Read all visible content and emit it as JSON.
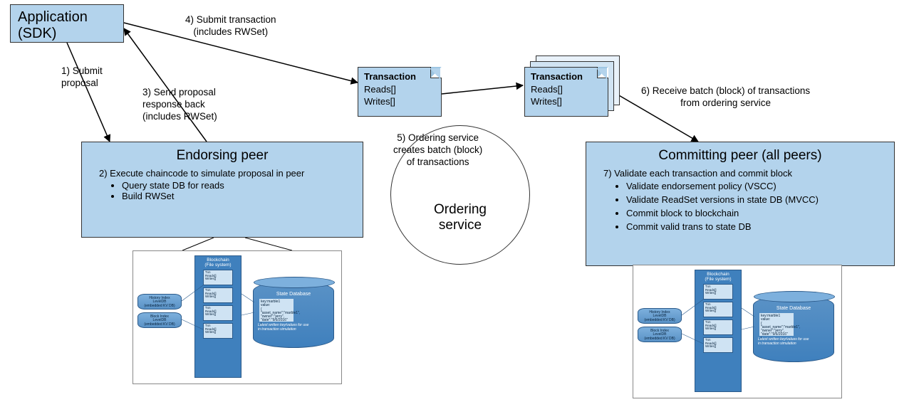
{
  "app": {
    "line1": "Application",
    "line2": "(SDK)"
  },
  "steps": {
    "s1": "1) Submit\nproposal",
    "s3": "3) Send proposal\nresponse back\n(includes RWSet)",
    "s4": "4) Submit transaction\n(includes RWSet)",
    "s5": "5) Ordering service\ncreates batch (block)\nof transactions",
    "s6": "6) Receive batch (block) of transactions\nfrom ordering service"
  },
  "endorsing": {
    "title": "Endorsing peer",
    "line": "2) Execute chaincode to simulate proposal in peer",
    "bullets": [
      "Query state DB for reads",
      "Build RWSet"
    ]
  },
  "committing": {
    "title": "Committing peer (all peers)",
    "line": "7) Validate each transaction and commit block",
    "bullets": [
      "Validate endorsement policy (VSCC)",
      "Validate ReadSet versions in state DB (MVCC)",
      "Commit block to blockchain",
      "Commit valid trans to state DB"
    ]
  },
  "tx_card": {
    "title": "Transaction",
    "r": "Reads[]",
    "w": "Writes[]"
  },
  "ordering": {
    "label": "Ordering\nservice"
  },
  "ledger": {
    "history_index": "History Index\nLevelDB\n(embedded KV DB)",
    "block_index": "Block Index\nLevelDB\n(embedded KV DB)",
    "blockchain_hdr": "Blockchain\n(File system)",
    "tiny": "Txn\nReads[]\nWrites[]",
    "statedb_title": "State Database",
    "statedb_kv": "key:marble1\nvalue:\n{\n\"asset_name\":\"marble1\",\n\"owner\":\"jerry\",\n\"date\":\"9/6/2016\"\n}",
    "statedb_note": "Latest written key/values for use\nin transaction simulation"
  }
}
